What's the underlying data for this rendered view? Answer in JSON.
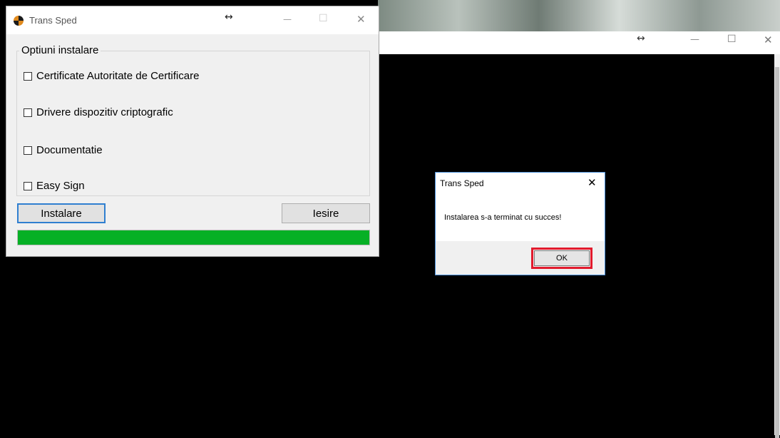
{
  "background_window": {
    "resize_glyph": "↔",
    "minimize": "—",
    "maximize": "☐",
    "close": "✕"
  },
  "main_window": {
    "title": "Trans Sped",
    "resize_glyph": "↔",
    "minimize": "—",
    "maximize": "☐",
    "close": "✕",
    "group_label": "Optiuni instalare",
    "options": [
      {
        "label": "Certificate Autoritate de Certificare",
        "checked": false
      },
      {
        "label": "Drivere dispozitiv criptografic",
        "checked": false
      },
      {
        "label": "Documentatie",
        "checked": false
      },
      {
        "label": "Easy Sign",
        "checked": false
      }
    ],
    "install_button": "Instalare",
    "exit_button": "Iesire",
    "progress_percent": 100,
    "progress_color": "#06b025"
  },
  "message_box": {
    "title": "Trans Sped",
    "close": "✕",
    "text": "Instalarea s-a terminat cu succes!",
    "ok_button": "OK",
    "highlight_color": "#e21b2d"
  }
}
